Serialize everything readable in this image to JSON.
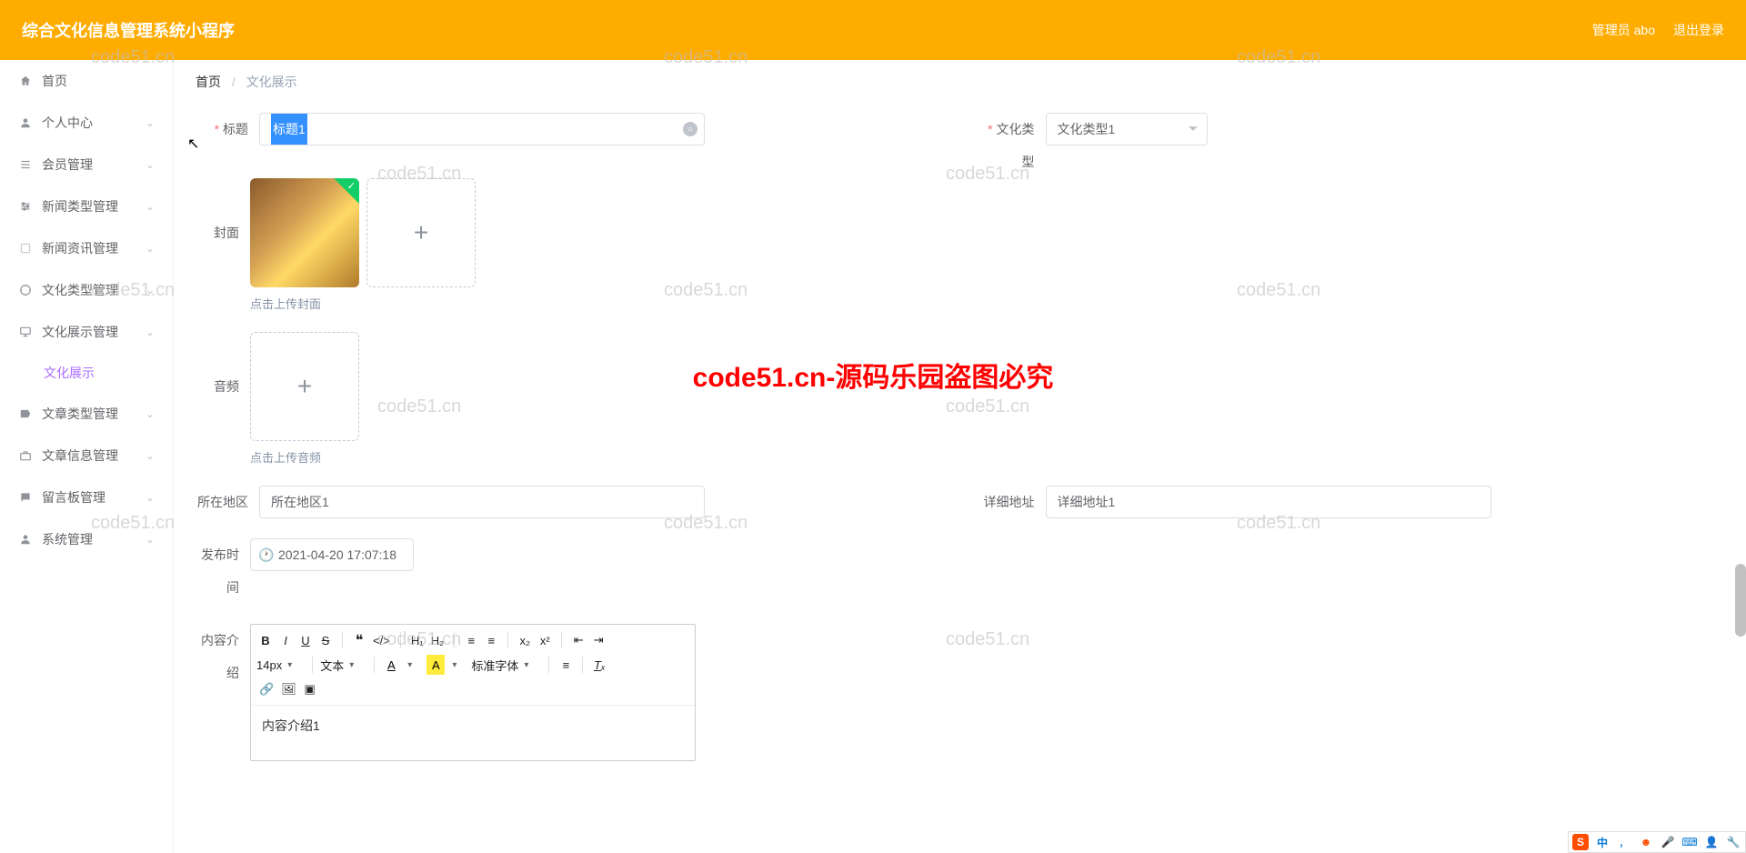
{
  "header": {
    "title": "综合文化信息管理系统小程序",
    "admin_label": "管理员 abo",
    "logout_label": "退出登录"
  },
  "sidebar": {
    "home": "首页",
    "items": [
      {
        "label": "个人中心"
      },
      {
        "label": "会员管理"
      },
      {
        "label": "新闻类型管理"
      },
      {
        "label": "新闻资讯管理"
      },
      {
        "label": "文化类型管理"
      },
      {
        "label": "文化展示管理"
      },
      {
        "label": "文章类型管理"
      },
      {
        "label": "文章信息管理"
      },
      {
        "label": "留言板管理"
      },
      {
        "label": "系统管理"
      }
    ],
    "active_sub": "文化展示"
  },
  "breadcrumb": {
    "home": "首页",
    "current": "文化展示"
  },
  "form": {
    "title_label": "标题",
    "title_value": "标题1",
    "type_label": "文化类型",
    "type_value": "文化类型1",
    "cover_label": "封面",
    "cover_hint": "点击上传封面",
    "audio_label": "音频",
    "audio_hint": "点击上传音频",
    "region_label": "所在地区",
    "region_value": "所在地区1",
    "address_label": "详细地址",
    "address_value": "详细地址1",
    "publish_label": "发布时间",
    "publish_value": "2021-04-20 17:07:18",
    "content_label": "内容介绍",
    "content_value": "内容介绍1"
  },
  "editor": {
    "font_size": "14px",
    "paragraph": "文本",
    "char_a": "A",
    "char_a2": "A",
    "font_family": "标准字体"
  },
  "watermarks": {
    "text": "code51.cn",
    "big": "code51.cn-源码乐园盗图必究"
  },
  "ime": {
    "zhong": "中",
    "comma": "，"
  }
}
